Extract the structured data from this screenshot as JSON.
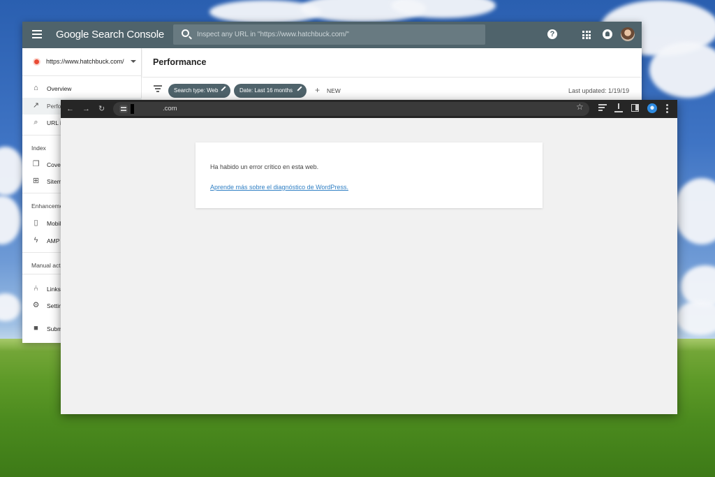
{
  "search_console": {
    "logo": "Google Search Console",
    "search_placeholder": "Inspect any URL in \"https://www.hatchbuck.com/\"",
    "property": "https://www.hatchbuck.com/",
    "page_title": "Performance",
    "nav": [
      {
        "label": "Overview",
        "icon": "home-icon"
      },
      {
        "label": "Perfo",
        "icon": "trending-up-icon"
      },
      {
        "label": "URL i",
        "icon": "search-icon"
      },
      {
        "label": "Cove",
        "icon": "copy-icon"
      },
      {
        "label": "Sitem",
        "icon": "sitemap-icon"
      },
      {
        "label": "Mobil",
        "icon": "phone-icon"
      },
      {
        "label": "AMP",
        "icon": "bolt-icon"
      },
      {
        "label": "Links",
        "icon": "links-icon"
      },
      {
        "label": "Settin",
        "icon": "gear-icon"
      },
      {
        "label": "Subm",
        "icon": "info-icon"
      }
    ],
    "sections": {
      "index": "Index",
      "enhancements": "Enhanceme",
      "manual_actions": "Manual acti"
    },
    "filters": {
      "search_type": "Search type: Web",
      "date": "Date: Last 16 months",
      "new_label": "NEW",
      "plus": "+"
    },
    "last_updated": "Last updated: 1/19/19"
  },
  "browser": {
    "url_suffix": ".com",
    "nav_back": "←",
    "nav_forward": "→",
    "nav_reload": "↻",
    "star": "☆",
    "error_message": "Ha habido un error crítico en esta web.",
    "error_link": "Aprende más sobre el diagnóstico de WordPress."
  },
  "colors": {
    "gsc_bar": "#4f636b",
    "browser_toolbar": "#262626",
    "link": "#2f7fc4"
  }
}
